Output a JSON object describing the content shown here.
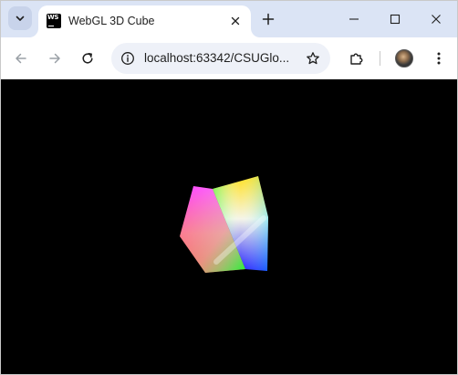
{
  "browser": {
    "tab": {
      "title": "WebGL 3D Cube",
      "favicon": "webstorm-icon"
    },
    "window_controls": [
      "minimize-icon",
      "maximize-icon",
      "close-icon"
    ],
    "omnibox": {
      "url": "localhost:63342/CSUGlo..."
    }
  },
  "viewport": {
    "background": "#000000",
    "scene": "rotating-color-cube"
  }
}
